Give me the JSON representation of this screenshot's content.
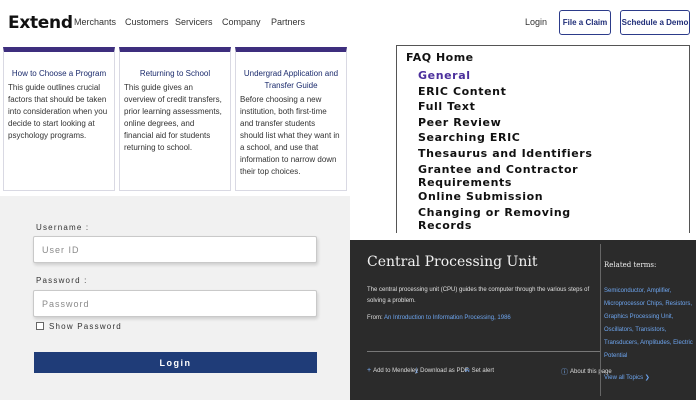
{
  "nav": {
    "logo": "Extend",
    "links": [
      "Merchants",
      "Customers",
      "Servicers",
      "Company",
      "Partners"
    ],
    "login": "Login",
    "file_claim": "File a Claim",
    "schedule_demo": "Schedule a Demo",
    "accent": "#3e2e7e"
  },
  "cards": [
    {
      "title": "How to Choose a Program",
      "body": "This guide outlines crucial factors that should be taken into consideration when you decide to start looking at psychology programs."
    },
    {
      "title": "Returning to School",
      "body": "This guide gives an overview of credit transfers, prior learning assessments, online degrees, and financial aid for students returning to school."
    },
    {
      "title": "Undergrad Application and Transfer Guide",
      "body": "Before choosing a new institution, both first-time and transfer students should list what they want in a school, and use that information to narrow down their top choices."
    }
  ],
  "faq": {
    "home": "FAQ Home",
    "items": [
      "General",
      "ERIC Content",
      "Full Text",
      "Peer Review",
      "Searching ERIC",
      "Thesaurus and Identifiers",
      "Grantee and Contractor",
      "Requirements",
      "Online Submission",
      "Changing or Removing",
      "Records"
    ],
    "current_color": "#4b2f9c"
  },
  "login": {
    "username_label": "Username :",
    "username_placeholder": "User ID",
    "password_label": "Password :",
    "password_placeholder": "Password",
    "show_password": "Show Password",
    "button": "Login",
    "button_color": "#1f3c78"
  },
  "cpu": {
    "title": "Central Processing Unit",
    "description": "The central processing unit (CPU) guides the computer through the various steps of solving a problem.",
    "from_label": "From:",
    "from_link": "An Introduction to Information Processing, 1986",
    "actions": {
      "mendeley": "Add to Mendeley",
      "pdf": "Download as PDF",
      "alert": "Set alert",
      "about": "About this page"
    },
    "related_title": "Related terms:",
    "related_terms": "Semiconductor, Amplifier, Microprocessor Chips, Resistors, Graphics Processing Unit, Oscillators, Transistors, Transducers, Amplitudes, Electric Potential",
    "view_all": "View all Topics  ❯",
    "background": "#2b2b2b",
    "link_color": "#6ea6f0"
  }
}
